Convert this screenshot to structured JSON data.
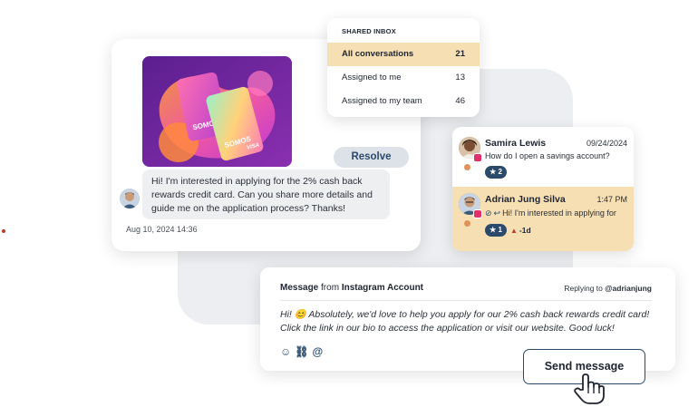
{
  "chat": {
    "message": "Hi! I'm interested in applying for the 2% cash back rewards credit card. Can you share more details and guide me on the application process? Thanks!",
    "timestamp": "Aug 10, 2024 14:36",
    "resolve_label": "Resolve",
    "card_brand": "SOMOS",
    "card_network": "VISA"
  },
  "inbox": {
    "title": "SHARED INBOX",
    "rows": [
      {
        "label": "All conversations",
        "count": "21",
        "active": true
      },
      {
        "label": "Assigned to me",
        "count": "13",
        "active": false
      },
      {
        "label": "Assigned to my team",
        "count": "46",
        "active": false
      }
    ]
  },
  "conversations": [
    {
      "name": "Samira Lewis",
      "date": "09/24/2024",
      "preview": "How do I open a savings account?",
      "stars": "2",
      "sla": ""
    },
    {
      "name": "Adrian Jung Silva",
      "date": "1:47 PM",
      "preview": "Hi! I'm interested in applying for",
      "stars": "1",
      "sla": "-1d"
    }
  ],
  "composer": {
    "prefix": "Message",
    "from_word": "from",
    "source": "Instagram Account",
    "replying_prefix": "Replying to",
    "replying_handle": "@adrianjung",
    "body": "Hi! 😊 Absolutely, we'd love to help you apply for our 2% cash back rewards credit card! Click the link in our bio to access the application or visit our website. Good luck!",
    "send_label": "Send message",
    "icons": [
      "emoji-icon",
      "link-icon",
      "attachment-icon"
    ]
  },
  "colors": {
    "accent_navy": "#2b4a6b",
    "highlight": "#f6dfb3",
    "instagram": "#e1306c",
    "status_orange": "#e0925a"
  }
}
